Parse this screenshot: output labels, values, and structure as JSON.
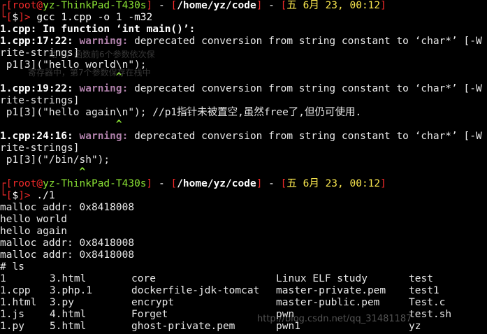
{
  "prompt1": {
    "user": "root",
    "host": "yz-ThinkPad-T430s",
    "path": "/home/yz/code",
    "date": "五 6月 23, 00:12",
    "command": "gcc 1.cpp -o 1 -m32"
  },
  "compile": {
    "in_function": "1.cpp: In function ‘int main()’:",
    "warnings": [
      {
        "loc": "1.cpp:17:22:",
        "label": "warning:",
        "msg": " deprecated conversion from string constant to ‘char*’ [-W",
        "cont": "rite-strings]",
        "src": " p1[3](\"hello world\\n\");",
        "caret": "                   ^"
      },
      {
        "loc": "1.cpp:19:22:",
        "label": "warning:",
        "msg": " deprecated conversion from string constant to ‘char*’ [-W",
        "cont": "rite-strings]",
        "src": " p1[3](\"hello again\\n\"); //p1指针未被置空,虽然free了,但仍可使用.",
        "caret": "                   ^"
      },
      {
        "loc": "1.cpp:24:16:",
        "label": "warning:",
        "msg": " deprecated conversion from string constant to ‘char*’ [-W",
        "cont": "rite-strings]",
        "src": " p1[3](\"/bin/sh\");",
        "caret": "             ^"
      }
    ]
  },
  "prompt2": {
    "user": "root",
    "host": "yz-ThinkPad-T430s",
    "path": "/home/yz/code",
    "date": "五 6月 23, 00:12",
    "command": "./1"
  },
  "output": [
    "malloc addr: 0x8418008",
    "hello world",
    "hello again",
    "malloc addr: 0x8418008",
    "malloc addr: 0x8418008"
  ],
  "shell_prompt": "# ls",
  "ls_rows": [
    [
      "1",
      "3.html",
      "core",
      "Linux ELF study",
      "test"
    ],
    [
      "1.cpp",
      "3.php.1",
      "dockerfile-jdk-tomcat",
      "master-private.pem",
      "test1"
    ],
    [
      "1.html",
      "3.py",
      "encrypt",
      "master-public.pem",
      "Test.c"
    ],
    [
      "1.js",
      "4.html",
      "Forget",
      "pwn",
      "test.sh"
    ],
    [
      "1.py",
      "5.html",
      "ghost-private.pem",
      "pwn1",
      "yz"
    ]
  ],
  "watermark": "http://blog.csdn.net/qq_31481187",
  "overlay_text": [
    "动下，函数前6个参数依次保",
    "寄存器中，第7个参数保存在栈中"
  ],
  "colors": {
    "background": "#000000",
    "prompt_bracket": "#ef2929",
    "host": "#8ae234",
    "warning": "#ad7fa8",
    "date": "#fce94f",
    "caret": "#8ae234"
  }
}
